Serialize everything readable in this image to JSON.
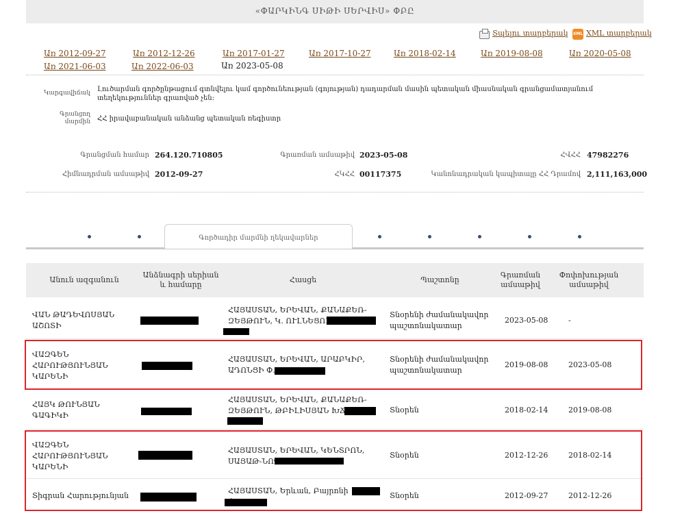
{
  "header": {
    "title": "«ՓԱՐԿԻՆԳ ՍԻԹԻ ՍԵՐՎԻՍ» ՓԲԸ"
  },
  "actions": {
    "print_label": "Տպելու տարբերակ",
    "xml_label": "XML տարբերակ",
    "xml_icon_text": "XML"
  },
  "dates": [
    "Առ 2012-09-27",
    "Առ 2012-12-26",
    "Առ 2017-01-27",
    "Առ 2017-10-27",
    "Առ 2018-02-14",
    "Առ 2019-08-08",
    "Առ 2020-05-08",
    "Առ 2021-06-03",
    "Առ 2022-06-03",
    "Առ 2023-05-08"
  ],
  "status": {
    "label": "Կարգավիճակ",
    "text": "Լուծարման գործընթացում գտնվելու կամ գործունեության (գոյության) դադարման մասին պետական միասնական գրանցամատյանում տեղեկություններ գրառված չեն:"
  },
  "registry": {
    "label": "Գրանցող մարմին",
    "value": "ՀՀ իրավաբանական անձանց պետական ռեգիստր"
  },
  "details": {
    "reg_number_label": "Գրանցման համար",
    "reg_number": "264.120.710805",
    "record_date_label": "Գրառման ամսաթիվ",
    "record_date": "2023-05-08",
    "tin_label": "ՀՎՀՀ",
    "tin": "47982276",
    "founding_date_label": "Հիմնադրման ամսաթիվ",
    "founding_date": "2012-09-27",
    "state_reg_label": "ՀԿՀՀ",
    "state_reg": "00117375",
    "capital_label": "Կանոնադրական կապիտալը ՀՀ Դրամով",
    "capital": "2,111,163,000"
  },
  "tabs": {
    "active_label": "Գործադիր մարմնի ղեկավարներ"
  },
  "table": {
    "headers": [
      "Անուն ազգանուն",
      "Անձնագրի սերիան և համարը",
      "Հասցե",
      "Պաշտոնը",
      "Գրառման ամսաթիվ",
      "Փոփոխության ամսաթիվ"
    ],
    "rows": [
      {
        "name": "ՎԱՆ ԹԱԴԵՎՈՍՅԱՆ ԱՇՈՏԻ",
        "address": "ՀԱՅԱՍՏԱՆ, ԵՐԵՎԱՆ, ՔԱՆԱՔԵՌ-ԶԵՅԹՈՒՆ, Կ. ՈՒԼՆԵՑՈՒ",
        "position": "Տնօրենի ժամանակավոր պաշտոնակատար",
        "record": "2023-05-08",
        "change": "-"
      },
      {
        "name": "ՎԱԶԳԵՆ ՀԱՐՈՒԹՅՈՒՆՅԱՆ ԿԱՐԵՆԻ",
        "address": "ՀԱՅԱՍՏԱՆ, ԵՐԵՎԱՆ, ԱՐԱԲԿԻՐ, ԱԴՈՆՑԻ Փ.,",
        "position": "Տնօրենի ժամանակավոր պաշտոնակատար",
        "record": "2019-08-08",
        "change": "2023-05-08"
      },
      {
        "name": "ՀԱՅԿ ԹՈՒՆՅԱՆ ԳԱԳԻԿԻ",
        "address": "ՀԱՅԱՍՏԱՆ, ԵՐԵՎԱՆ, ՔԱՆԱՔԵՌ-ԶԵՅԹՈՒՆ, ԹԲԻԼԻՍՅԱՆ ԽՃՂ.",
        "position": "Տնօրեն",
        "record": "2018-02-14",
        "change": "2019-08-08"
      },
      {
        "name": "ՎԱԶԳԵՆ ՀԱՐՈՒԹՅՈՒՆՅԱՆ ԿԱՐԵՆԻ",
        "address": "ՀԱՅԱՍՏԱՆ, ԵՐԵՎԱՆ, ԿԵՆՏՐՈՆ, ՍԱՅԱԹ-ՆՈՎԱՅԻ",
        "position": "Տնօրեն",
        "record": "2012-12-26",
        "change": "2018-02-14"
      },
      {
        "name": "Տիգրան Հարությունյան",
        "address": "ՀԱՅԱՍՏԱՆ, Երևան, Բայրոնի փ.,",
        "position": "Տնօրեն",
        "record": "2012-09-27",
        "change": "2012-12-26"
      }
    ]
  }
}
